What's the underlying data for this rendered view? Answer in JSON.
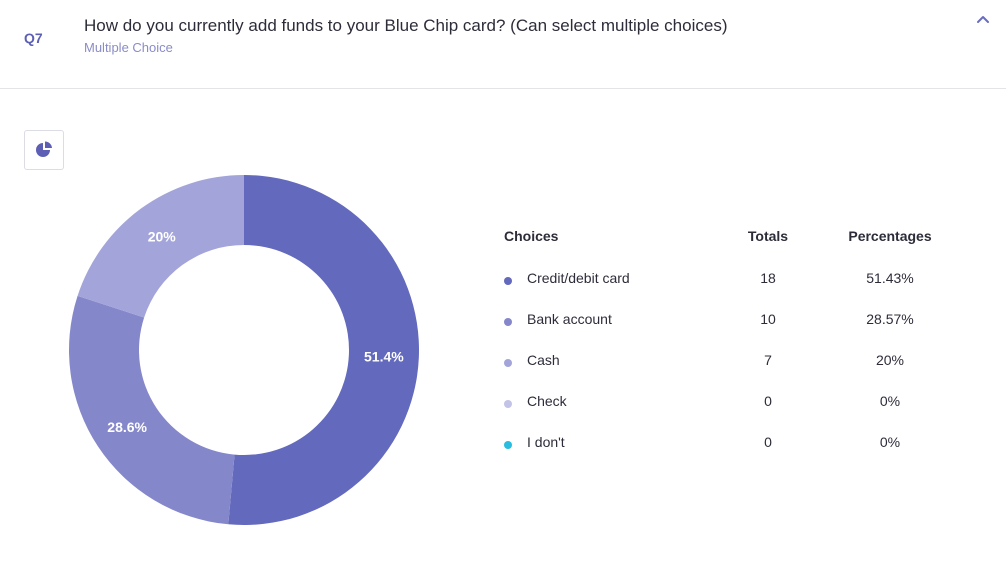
{
  "question": {
    "number": "Q7",
    "title": "How do you currently add funds to your Blue Chip card? (Can select multiple choices)",
    "type": "Multiple Choice"
  },
  "icons": {
    "collapse": "chevron-up-icon",
    "chart_type": "pie-chart-icon"
  },
  "table": {
    "headers": {
      "choices": "Choices",
      "totals": "Totals",
      "percentages": "Percentages"
    },
    "rows": [
      {
        "choice": "Credit/debit card",
        "total": "18",
        "percentage": "51.43%",
        "color": "#6369bd"
      },
      {
        "choice": "Bank account",
        "total": "10",
        "percentage": "28.57%",
        "color": "#8587cb"
      },
      {
        "choice": "Cash",
        "total": "7",
        "percentage": "20%",
        "color": "#a3a5da"
      },
      {
        "choice": "Check",
        "total": "0",
        "percentage": "0%",
        "color": "#c2c3e6"
      },
      {
        "choice": "I don't",
        "total": "0",
        "percentage": "0%",
        "color": "#29bde0"
      }
    ]
  },
  "chart_data": {
    "type": "pie",
    "categories": [
      "Credit/debit card",
      "Bank account",
      "Cash",
      "Check",
      "I don't"
    ],
    "values": [
      51.43,
      28.57,
      20,
      0,
      0
    ],
    "slice_labels": [
      "51.4%",
      "28.6%",
      "20%",
      "",
      ""
    ],
    "colors": [
      "#6369bd",
      "#8587cb",
      "#a3a5da",
      "#c2c3e6",
      "#29bde0"
    ],
    "donut": true,
    "legend": "right"
  }
}
